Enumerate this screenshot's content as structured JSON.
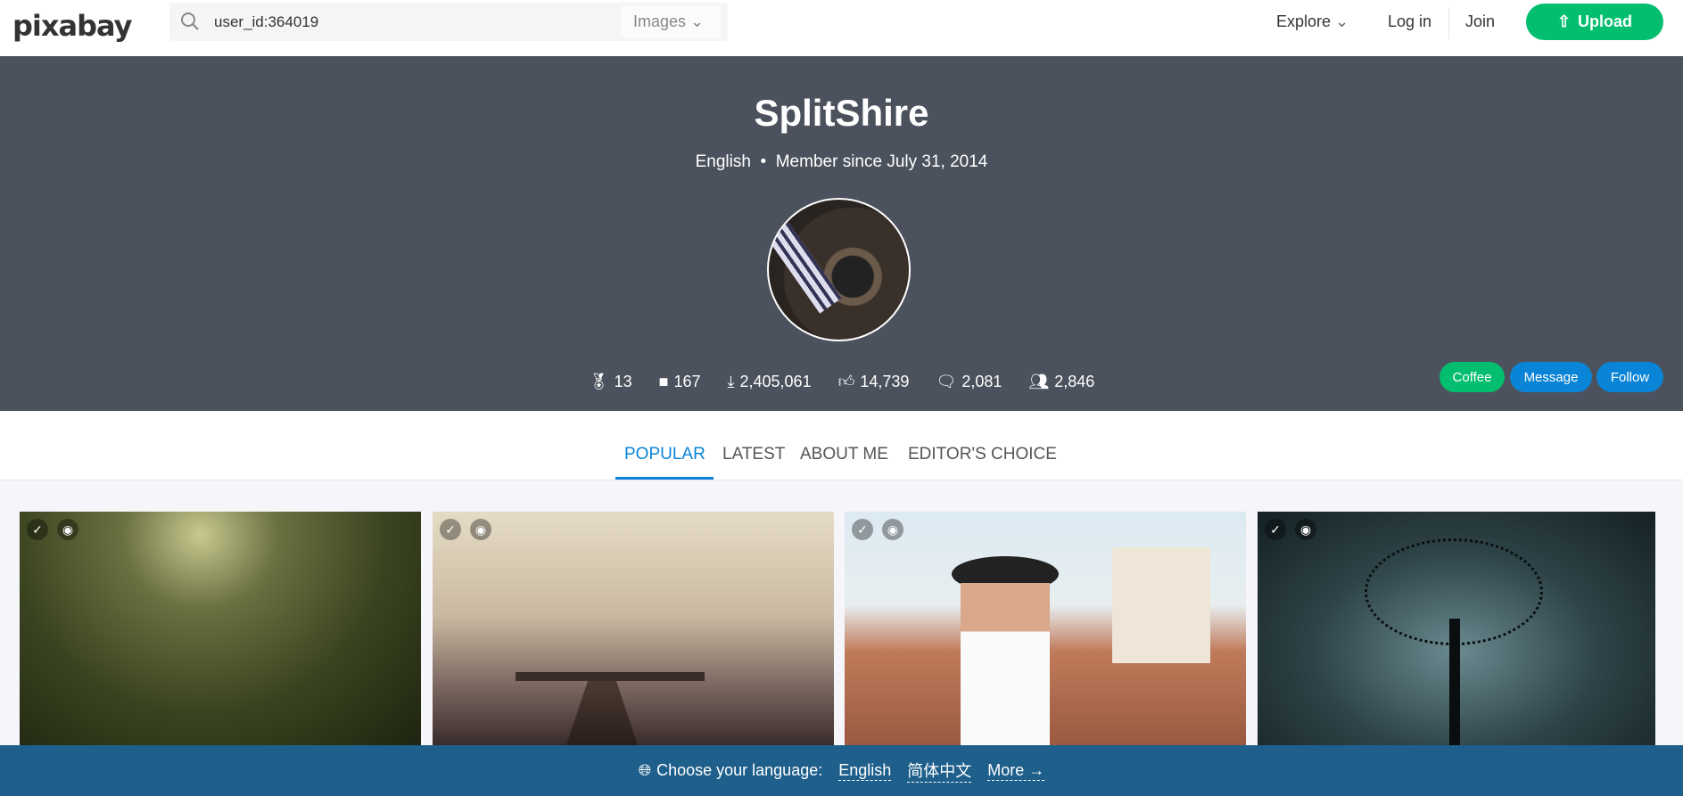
{
  "header": {
    "logo": "pixabay",
    "search_value": "user_id:364019",
    "search_type": "Images",
    "explore": "Explore",
    "login": "Log in",
    "join": "Join",
    "upload": "Upload"
  },
  "profile": {
    "name": "SplitShire",
    "language": "English",
    "member_since": "Member since July 31, 2014",
    "stats": [
      {
        "icon": "award-icon",
        "value": "13"
      },
      {
        "icon": "image-icon",
        "value": "167"
      },
      {
        "icon": "download-icon",
        "value": "2,405,061"
      },
      {
        "icon": "thumbs-up-icon",
        "value": "14,739"
      },
      {
        "icon": "comment-icon",
        "value": "2,081"
      },
      {
        "icon": "followers-icon",
        "value": "2,846"
      }
    ],
    "buttons": {
      "coffee": "Coffee",
      "message": "Message",
      "follow": "Follow"
    }
  },
  "tabs": [
    {
      "label": "POPULAR",
      "active": true
    },
    {
      "label": "LATEST"
    },
    {
      "label": "ABOUT ME"
    },
    {
      "label": "EDITOR'S CHOICE"
    }
  ],
  "images": [
    {
      "subject": "forest path"
    },
    {
      "subject": "pier in fog"
    },
    {
      "subject": "woman with camera"
    },
    {
      "subject": "bare tree"
    }
  ],
  "footer": {
    "prompt": "Choose your language:",
    "langs": [
      "English",
      "简体中文"
    ],
    "more": "More →"
  },
  "colors": {
    "accent": "#0a84d6",
    "green": "#02be6e",
    "banner": "#4b525d",
    "footer": "#1f5f8b"
  }
}
